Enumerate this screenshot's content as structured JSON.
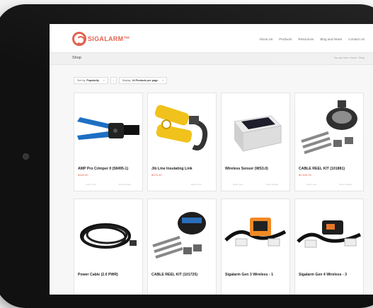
{
  "header": {
    "logo_text": "SIGALARM™",
    "nav": [
      "About Us",
      "Products",
      "Resources",
      "Blog and News",
      "Contact Us"
    ]
  },
  "page": {
    "title": "Shop",
    "breadcrumbs": "You are here: Home / Shop"
  },
  "toolbar": {
    "sort_label": "Sort by",
    "sort_value": "Popularity",
    "display_label": "Display",
    "display_value": "24 Products per page"
  },
  "products": [
    {
      "name": "AMP Pro Crimper II (58495-1)",
      "price": "$183.00",
      "add": "Add to cart",
      "details": "Show Details",
      "icon": "crimper-tool-icon"
    },
    {
      "name": "Jib Line Insulating Link",
      "price": "$375.00",
      "add": "",
      "details": "Read more",
      "icon": "insulating-link-icon"
    },
    {
      "name": "Wireless Sensor (WS3.0)",
      "price": "",
      "add": "Read more",
      "details": "Show Details",
      "icon": "wireless-sensor-icon"
    },
    {
      "name": "CABLE REEL KIT (101881)",
      "price": "$2,540.00",
      "add": "Add to cart",
      "details": "Show Details",
      "icon": "cable-reel-icon"
    },
    {
      "name": "Power Cable (2.0 PWR)",
      "price": "",
      "add": "",
      "details": "",
      "icon": "power-cable-icon"
    },
    {
      "name": "CABLE REEL KIT (101725)",
      "price": "",
      "add": "",
      "details": "",
      "icon": "cable-reel-icon"
    },
    {
      "name": "Sigalarm Gen 3 Wireless - 1",
      "price": "",
      "add": "",
      "details": "",
      "icon": "gen3-wireless-icon"
    },
    {
      "name": "Sigalarm Gen 4 Wireless - 3",
      "price": "",
      "add": "",
      "details": "",
      "icon": "gen4-wireless-icon"
    }
  ]
}
